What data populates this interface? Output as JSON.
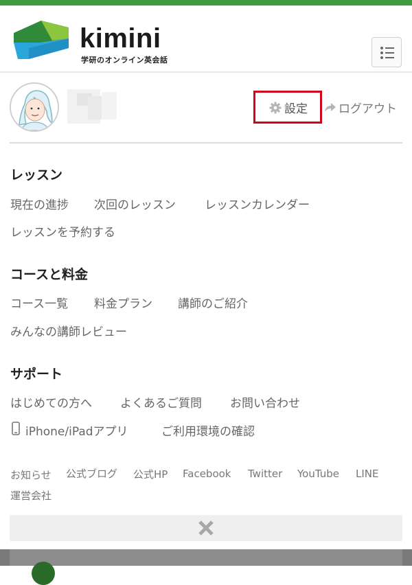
{
  "brand": {
    "name": "kimini",
    "tagline": "学研のオンライン英会話",
    "colors": {
      "green": "#3d9a3d",
      "blue": "#2aa6dc",
      "highlight": "#d0021b"
    }
  },
  "header": {
    "menu_icon": "list-menu-icon"
  },
  "profile": {
    "avatar_icon": "user-avatar-icon",
    "settings_label": "設定",
    "settings_icon": "gear-icon",
    "logout_label": "ログアウト",
    "logout_icon": "share-arrow-icon"
  },
  "sections": {
    "lesson": {
      "title": "レッスン",
      "links": [
        "現在の進捗",
        "次回のレッスン",
        "レッスンカレンダー",
        "レッスンを予約する"
      ]
    },
    "course": {
      "title": "コースと料金",
      "links": [
        "コース一覧",
        "料金プラン",
        "講師のご紹介",
        "みんなの講師レビュー"
      ]
    },
    "support": {
      "title": "サポート",
      "links": [
        "はじめての方へ",
        "よくあるご質問",
        "お問い合わせ",
        "iPhone/iPadアプリ",
        "ご利用環境の確認"
      ]
    }
  },
  "footer": {
    "links": [
      "お知らせ",
      "公式ブログ",
      "公式HP",
      "Facebook",
      "Twitter",
      "YouTube",
      "LINE",
      "運営会社"
    ]
  },
  "close_icon": "close-x-icon"
}
